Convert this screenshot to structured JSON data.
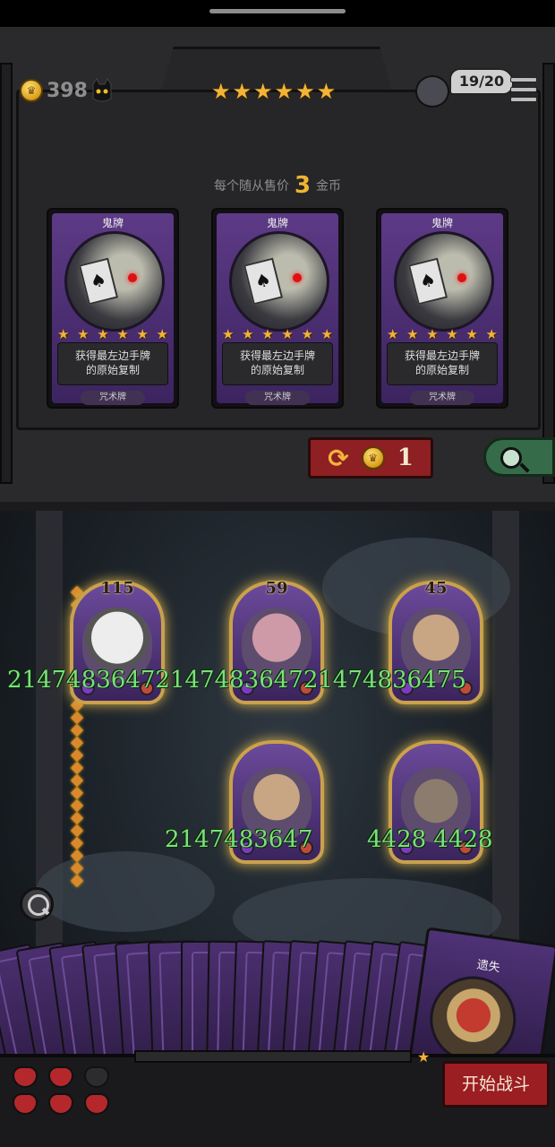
{
  "topbar": {
    "gold": "398",
    "tavern_stars": [
      "★",
      "★",
      "★",
      "★",
      "★",
      "★"
    ],
    "hand_count": "19/20"
  },
  "shop": {
    "price_prefix": "每个随从售价",
    "price_value": "3",
    "price_suffix": "金币",
    "cards": [
      {
        "name": "鬼牌",
        "desc_line1": "获得最左边手牌",
        "desc_line2": "的原始复制",
        "type": "咒术牌",
        "stars": [
          "★",
          "★",
          "★",
          "★",
          "★",
          "★"
        ]
      },
      {
        "name": "鬼牌",
        "desc_line1": "获得最左边手牌",
        "desc_line2": "的原始复制",
        "type": "咒术牌",
        "stars": [
          "★",
          "★",
          "★",
          "★",
          "★",
          "★"
        ]
      },
      {
        "name": "鬼牌",
        "desc_line1": "获得最左边手牌",
        "desc_line2": "的原始复制",
        "type": "咒术牌",
        "stars": [
          "★",
          "★",
          "★",
          "★",
          "★",
          "★"
        ]
      }
    ],
    "reroll_cost": "1",
    "reroll_icon": "refresh-icon"
  },
  "board": {
    "row1_counts": [
      "115",
      "59",
      "45"
    ],
    "row1_stats": "2147483647214748364721474836475",
    "row2_stats_left": "2147483647",
    "row2_stats_right": "4428 4428"
  },
  "hand": {
    "featured_name": "遗失"
  },
  "footer": {
    "start_label": "开始战斗"
  },
  "colors": {
    "gold": "#f3b334",
    "panel": "#262628",
    "card_purple": "#5d3a86",
    "stat_green": "#7be07b",
    "button_red": "#9b1e22"
  }
}
